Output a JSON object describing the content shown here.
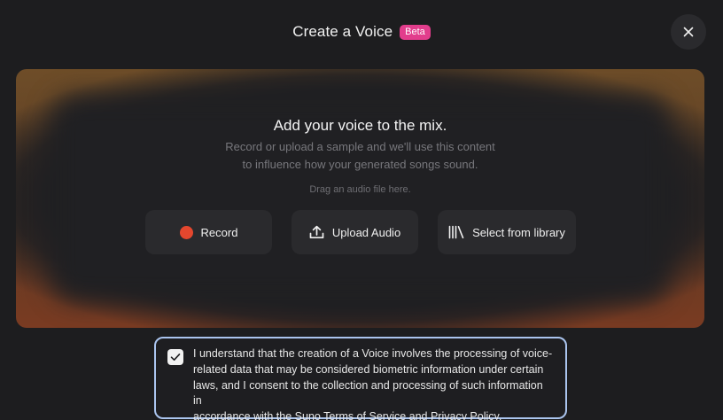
{
  "header": {
    "title": "Create a Voice",
    "badge": "Beta",
    "close_icon": "close-icon"
  },
  "dropzone": {
    "heading": "Add your voice to the mix.",
    "description_line1": "Record or upload a sample and we'll use this content",
    "description_line2": "to influence how your generated songs sound.",
    "hint": "Drag an audio file here."
  },
  "actions": {
    "record": {
      "label": "Record",
      "icon": "record-dot-icon"
    },
    "upload": {
      "label": "Upload Audio",
      "icon": "upload-icon"
    },
    "library": {
      "label": "Select from library",
      "icon": "library-icon"
    }
  },
  "consent": {
    "checked": true,
    "line1": "I understand that the creation of a Voice involves the processing of voice-",
    "line2": "related data that may be considered biometric information under certain",
    "line3": "laws, and I consent to the collection and processing of such information in",
    "line4": "accordance with the Suno Terms of Service and Privacy Policy."
  },
  "colors": {
    "background": "#1d1d1f",
    "badge": "#e23d8c",
    "record": "#e4472e",
    "consent_border": "#aac4ee",
    "glow_top": "#6e4d28",
    "glow_bottom": "#7a3b22"
  }
}
